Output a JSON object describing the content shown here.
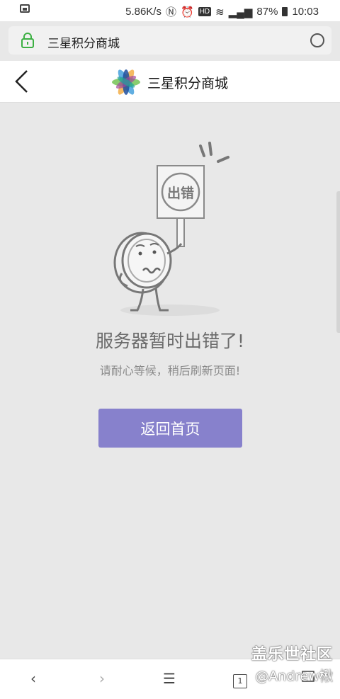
{
  "status_bar": {
    "speed": "5.86K/s",
    "hd": "HD",
    "battery": "87%",
    "time": "10:03"
  },
  "url_bar": {
    "url": "三星积分商城"
  },
  "header": {
    "title": "三星积分商城"
  },
  "error": {
    "sign_text": "出错",
    "title": "服务器暂时出错了!",
    "subtitle": "请耐心等候，稍后刷新页面!",
    "button": "返回首页"
  },
  "bottom_bar": {
    "back": "‹",
    "forward": "›",
    "menu": "☰",
    "tab_count": "1"
  },
  "watermark": {
    "line1": "盖乐世社区",
    "line2": "@Andrew楸"
  },
  "colors": {
    "accent_button": "#8781cc",
    "lock_green": "#3cb043"
  }
}
